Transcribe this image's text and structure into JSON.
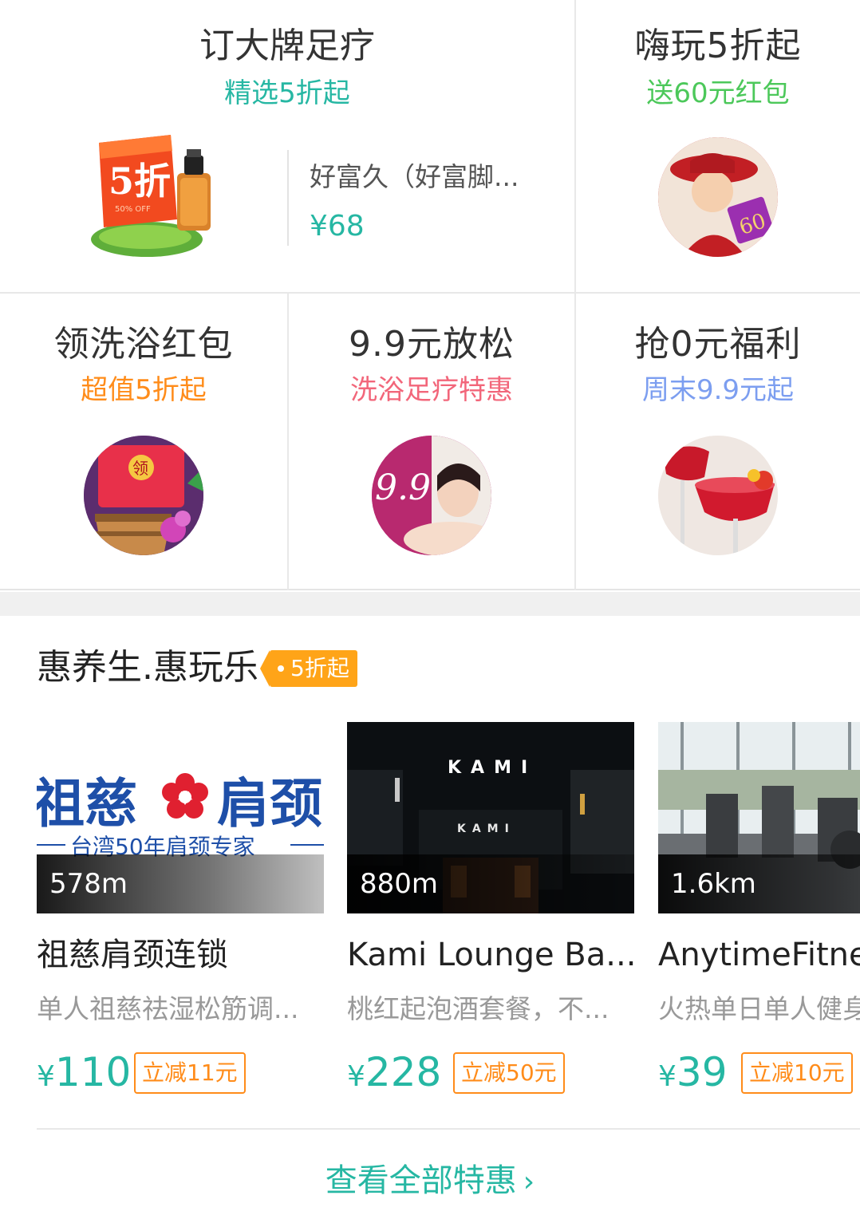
{
  "promos": {
    "big": {
      "title": "订大牌足疗",
      "subtitle": "精选5折起",
      "subtitle_color": "#26b7a3",
      "badge_text": "5折",
      "badge_sub": "50% OFF",
      "product_name": "好富久（好富脚...",
      "product_price": "¥68"
    },
    "top_right": {
      "title": "嗨玩5折起",
      "subtitle": "送60元红包",
      "subtitle_color": "#4cc85a",
      "badge": "60"
    },
    "row2": [
      {
        "title": "领洗浴红包",
        "subtitle": "超值5折起",
        "subtitle_color": "#ff8c1a",
        "badge": "领"
      },
      {
        "title": "9.9元放松",
        "subtitle": "洗浴足疗特惠",
        "subtitle_color": "#f2667a",
        "badge": "9.9"
      },
      {
        "title": "抢0元福利",
        "subtitle": "周末9.9元起",
        "subtitle_color": "#7c9ef0"
      }
    ]
  },
  "section": {
    "title": "惠养生.惠玩乐",
    "tag": "5折起",
    "cards": [
      {
        "distance": "578m",
        "name": "祖慈肩颈连锁",
        "desc": "单人祖慈祛湿松筋调...",
        "yen": "¥",
        "price": "110",
        "coupon": "立减11元",
        "logo_text_left": "祖慈",
        "logo_text_right": "肩颈",
        "logo_sub": "台湾50年肩颈专家"
      },
      {
        "distance": "880m",
        "name": "Kami Lounge Ba...",
        "desc": "桃红起泡酒套餐，不...",
        "yen": "¥",
        "price": "228",
        "coupon": "立减50元",
        "sign_top": "KAMI",
        "sign_bottom": "KAMI"
      },
      {
        "distance": "1.6km",
        "name": "AnytimeFitness",
        "desc": "火热单日单人健身",
        "yen": "¥",
        "price": "39",
        "coupon": "立减10元"
      }
    ],
    "more": "查看全部特惠",
    "more_chevron": "›"
  }
}
